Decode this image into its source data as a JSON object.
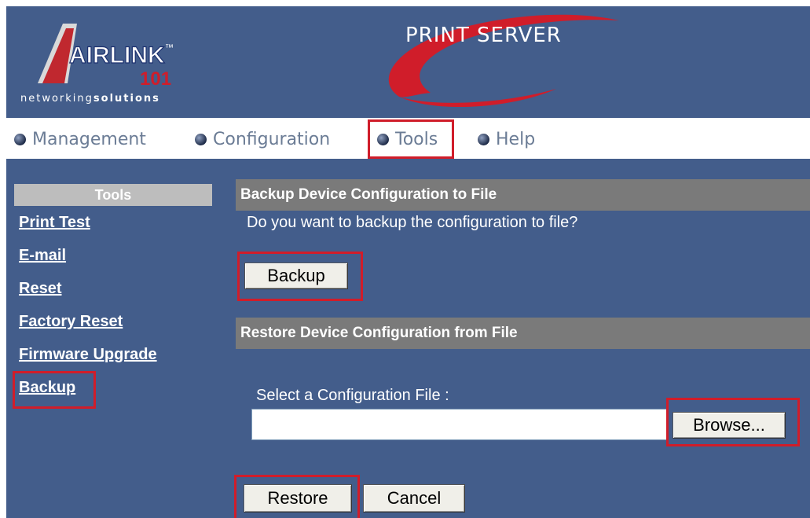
{
  "header": {
    "logo_text": "AIRLINK",
    "logo_number": "101",
    "logo_tm": "™",
    "tagline_prefix": "networking",
    "tagline_suffix": "solutions",
    "title": "PRINT SERVER"
  },
  "nav": {
    "items": [
      {
        "label": "Management"
      },
      {
        "label": "Configuration"
      },
      {
        "label": "Tools"
      },
      {
        "label": "Help"
      }
    ]
  },
  "sidebar": {
    "title": "Tools",
    "items": [
      {
        "label": "Print Test"
      },
      {
        "label": "E-mail"
      },
      {
        "label": "Reset"
      },
      {
        "label": "Factory Reset"
      },
      {
        "label": "Firmware Upgrade"
      },
      {
        "label": "Backup"
      }
    ]
  },
  "backup": {
    "heading": "Backup Device Configuration to File",
    "question": "Do you want to backup the configuration to file?",
    "button": "Backup"
  },
  "restore": {
    "heading": "Restore Device Configuration from File",
    "file_label": "Select a Configuration File :",
    "file_value": "",
    "browse_button": "Browse...",
    "restore_button": "Restore",
    "cancel_button": "Cancel"
  },
  "colors": {
    "background": "#435d8b",
    "highlight": "#d01d2a",
    "section_header": "#7a7a7a",
    "sidebar_header": "#bdbdbd"
  }
}
